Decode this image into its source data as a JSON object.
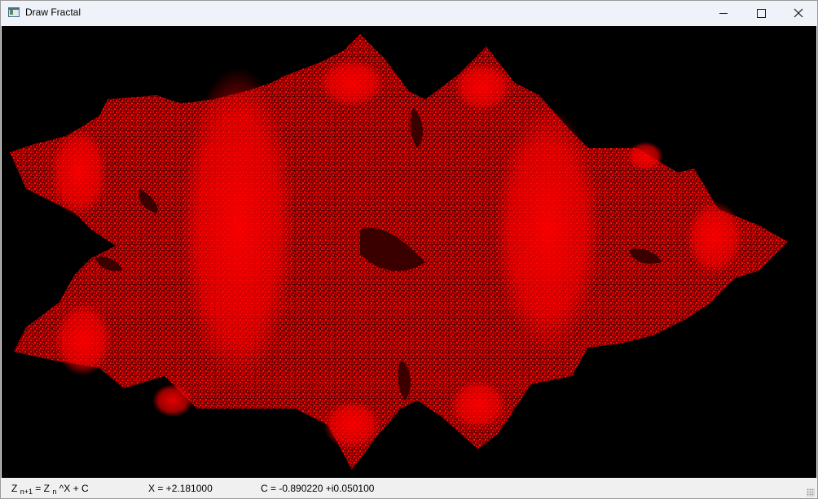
{
  "window": {
    "title": "Draw Fractal"
  },
  "icons": {
    "app": "app-window-icon",
    "minimize": "minimize-icon",
    "maximize": "maximize-icon",
    "close": "close-icon"
  },
  "colors": {
    "fractal": "#ff0000",
    "background": "#000000",
    "statusbar": "#f0f0f0",
    "titlebar": "#eff3f9"
  },
  "statusbar": {
    "formula_z1": "Z",
    "formula_sub1": "n+1",
    "formula_eq": " = Z",
    "formula_sub2": "n",
    "formula_rest": " ^X + C",
    "x_value": "X = +2.181000",
    "c_value": "C = -0.890220 +i0.050100"
  }
}
